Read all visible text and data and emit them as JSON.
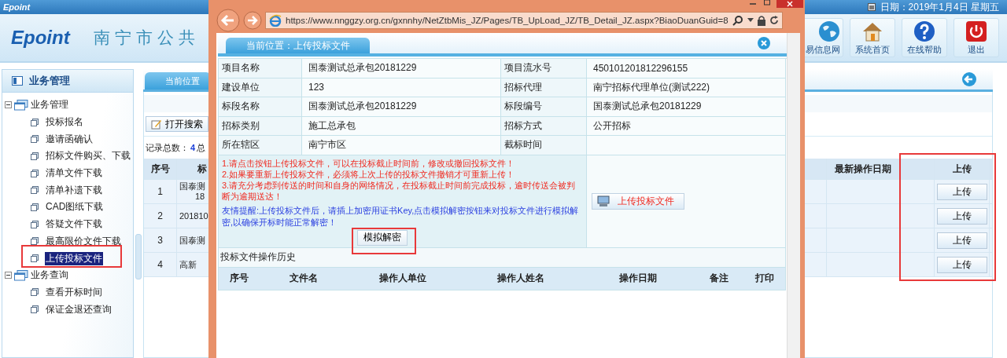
{
  "top_bar": {
    "logo": "Epoint",
    "date": "日期：2019年1月4日 星期五"
  },
  "header": {
    "logo": "Epoint",
    "title": "南宁市公共",
    "nav_buttons": [
      {
        "label": "易信息网"
      },
      {
        "label": "系统首页"
      },
      {
        "label": "在线帮助"
      },
      {
        "label": "退出"
      }
    ]
  },
  "sidebar": {
    "title": "业务管理",
    "tree": [
      {
        "label": "业务管理",
        "expanded": true,
        "children": [
          {
            "label": "投标报名",
            "selected": false
          },
          {
            "label": "邀请函确认",
            "selected": false
          },
          {
            "label": "招标文件购买、下载",
            "selected": false
          },
          {
            "label": "清单文件下载",
            "selected": false
          },
          {
            "label": "清单补遗下载",
            "selected": false
          },
          {
            "label": "CAD图纸下载",
            "selected": false
          },
          {
            "label": "答疑文件下载",
            "selected": false
          },
          {
            "label": "最高限价文件下载",
            "selected": false
          },
          {
            "label": "上传投标文件",
            "selected": true
          }
        ]
      },
      {
        "label": "业务查询",
        "expanded": true,
        "children": [
          {
            "label": "查看开标时间",
            "selected": false
          },
          {
            "label": "保证金退还查询",
            "selected": false
          }
        ]
      }
    ]
  },
  "main": {
    "tab": "当前位置",
    "search_button": "打开搜索",
    "record_label": "记录总数：",
    "record_count": "4",
    "record_more": "总",
    "table": {
      "columns": [
        "序号",
        "标",
        "最新操作日期",
        "上传"
      ],
      "rows": [
        {
          "no": "1",
          "column_2": [
            "国泰测",
            "18"
          ],
          "upload": "上传"
        },
        {
          "no": "2",
          "column_2": [
            "201810"
          ],
          "upload": "上传"
        },
        {
          "no": "3",
          "column_2": [
            "国泰测"
          ],
          "upload": "上传"
        },
        {
          "no": "4",
          "column_2": [
            "高新"
          ],
          "upload": "上传"
        }
      ]
    }
  },
  "popup": {
    "url": "https://www.nnggzy.org.cn/gxnnhy/NetZtbMis_JZ/Pages/TB_UpLoad_JZ/TB_Detail_JZ.aspx?BiaoDuanGuid=8",
    "tab": "当前位置：上传投标文件",
    "fields": [
      {
        "label": "项目名称",
        "value": "国泰测试总承包20181229"
      },
      {
        "label": "项目流水号",
        "value": "450101201812296155"
      },
      {
        "label": "建设单位",
        "value": "123"
      },
      {
        "label": "招标代理",
        "value": "南宁招标代理单位(测试222)"
      },
      {
        "label": "标段名称",
        "value": "国泰测试总承包20181229"
      },
      {
        "label": "标段编号",
        "value": "国泰测试总承包20181229"
      },
      {
        "label": "招标类别",
        "value": "施工总承包"
      },
      {
        "label": "招标方式",
        "value": "公开招标"
      },
      {
        "label": "所在辖区",
        "value": "南宁市区"
      },
      {
        "label": "截标时间"
      }
    ],
    "notices": [
      "1.请点击按钮上传投标文件，可以在投标截止时间前，修改或撤回投标文件！",
      "2.如果要重新上传投标文件，必须将上次上传的投标文件撤销才可重新上传！",
      "3.请充分考虑到传送的时间和自身的网络情况，在投标截止时间前完成投标，逾时传送会被判断为逾期送达！"
    ],
    "tip": "友情提醒:上传投标文件后，请插上加密用证书Key,点击模拟解密按钮来对投标文件进行模拟解密,以确保开标时能正常解密！",
    "decrypt_button": "模拟解密",
    "upload_button": "上传投标文件",
    "history_title": "投标文件操作历史",
    "history_columns": [
      "序号",
      "文件名",
      "操作人单位",
      "操作人姓名",
      "操作日期",
      "备注",
      "打印"
    ]
  }
}
